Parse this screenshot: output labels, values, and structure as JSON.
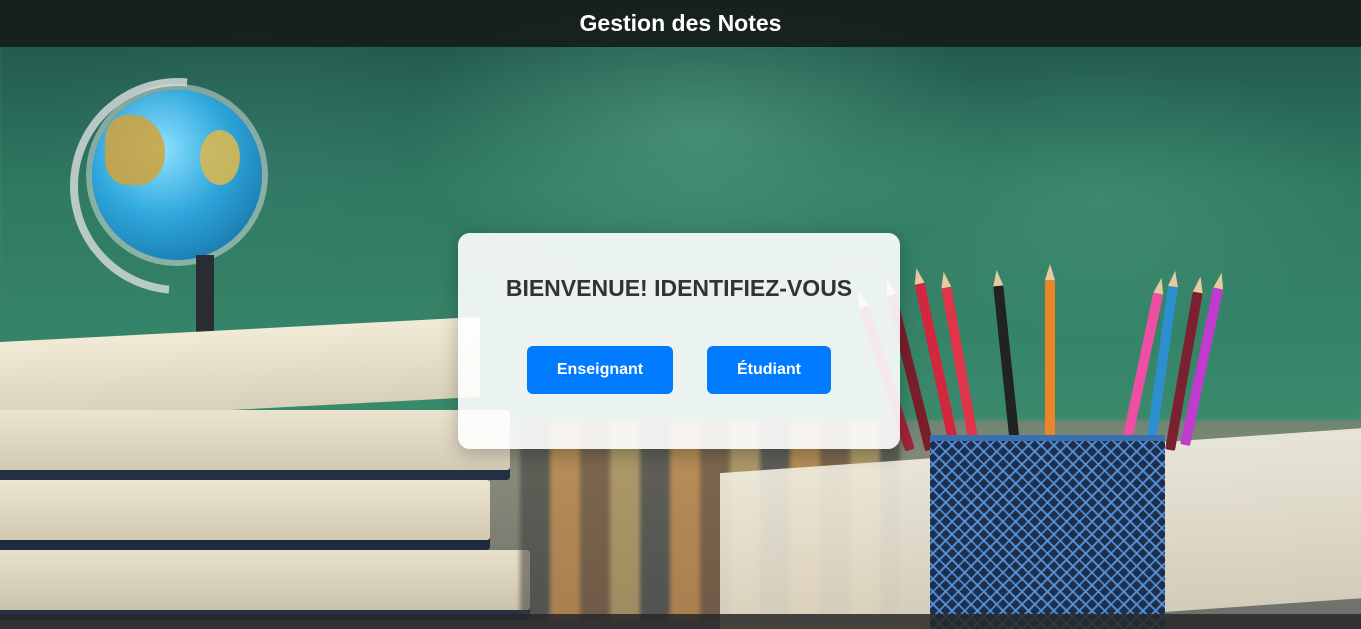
{
  "header": {
    "title": "Gestion des Notes"
  },
  "login_card": {
    "title": "BIENVENUE! IDENTIFIEZ-VOUS",
    "teacher_button": "Enseignant",
    "student_button": "Étudiant"
  },
  "colors": {
    "primary_button": "#007bff",
    "header_bg": "#141919",
    "card_title": "#333333"
  }
}
